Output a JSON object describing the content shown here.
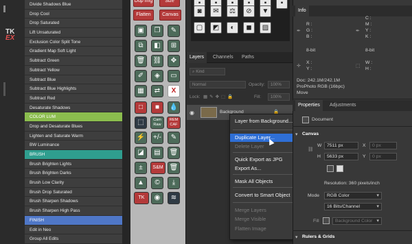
{
  "actions": [
    {
      "label": "Divide Shadows Blue",
      "type": "item"
    },
    {
      "label": "Drop Cool",
      "type": "item"
    },
    {
      "label": "Drop Saturated",
      "type": "item"
    },
    {
      "label": "Lift Unsaturated",
      "type": "item"
    },
    {
      "label": "Exclusion Color Split Tone",
      "type": "item"
    },
    {
      "label": "Gradient Map Soft Light",
      "type": "item"
    },
    {
      "label": "Subtract Green",
      "type": "item"
    },
    {
      "label": "Subtract Yellow",
      "type": "item"
    },
    {
      "label": "Subtract Blue",
      "type": "item"
    },
    {
      "label": "Subtract Blue Highlights",
      "type": "item"
    },
    {
      "label": "Subtract Red",
      "type": "item"
    },
    {
      "label": "Desaturate Shadows",
      "type": "item"
    },
    {
      "label": "COLOR LUM",
      "type": "hdr-green"
    },
    {
      "label": "Drop and Desaturate Blues",
      "type": "item"
    },
    {
      "label": "Lighten and Saturate Warm",
      "type": "item"
    },
    {
      "label": "BW Luminance",
      "type": "item"
    },
    {
      "label": "BRUSH",
      "type": "hdr-teal"
    },
    {
      "label": "Brush Brighten Lights",
      "type": "item"
    },
    {
      "label": "Brush Brighten Darks",
      "type": "item"
    },
    {
      "label": "Brush Low Clarity",
      "type": "item"
    },
    {
      "label": "Brush Drop Saturated",
      "type": "item"
    },
    {
      "label": "Brush Sharpen Shadows",
      "type": "item"
    },
    {
      "label": "Brush Sharpen High Pass",
      "type": "item"
    },
    {
      "label": "FINISH",
      "type": "hdr-blue"
    },
    {
      "label": "Edit in Neo",
      "type": "item"
    },
    {
      "label": "Group All Edits",
      "type": "item"
    }
  ],
  "strip": {
    "logo_line1": "TK",
    "logo_line2": "EX"
  },
  "buttons": {
    "dup_img": "Dup Img",
    "size": "Size",
    "flatten": "Flatten",
    "canvas": "Canvas",
    "cam_raw": "Cam Raw",
    "rem_caf": "REM CAF",
    "plus_minus": "+/-",
    "sam": "S&M",
    "tk": "TK",
    "x": "X",
    "pm_num": "±"
  },
  "layers_panel": {
    "tabs": [
      "Layers",
      "Channels",
      "Paths"
    ],
    "kind_placeholder": "Kind",
    "blend_mode": "Normal",
    "opacity_label": "Opacity:",
    "opacity_value": "100%",
    "lock_label": "Lock:",
    "fill_label": "Fill:",
    "fill_value": "100%",
    "layer_name": "Background"
  },
  "context_menu": {
    "items": [
      {
        "label": "Layer from Background...",
        "state": "normal"
      },
      {
        "label": "Duplicate Layer...",
        "state": "selected"
      },
      {
        "label": "Delete Layer",
        "state": "disabled"
      },
      {
        "label": "Quick Export as JPG",
        "state": "normal"
      },
      {
        "label": "Export As...",
        "state": "normal"
      },
      {
        "label": "Mask All Objects",
        "state": "normal"
      },
      {
        "label": "Convert to Smart Object",
        "state": "normal"
      },
      {
        "label": "Merge Layers",
        "state": "disabled"
      },
      {
        "label": "Merge Visible",
        "state": "disabled"
      },
      {
        "label": "Flatten Image",
        "state": "disabled"
      }
    ]
  },
  "info_panel": {
    "title": "Info",
    "r": "R :",
    "g": "G :",
    "b": "B :",
    "bit_left": "8-bit",
    "c": "C :",
    "m": "M :",
    "y": "Y :",
    "k": "K :",
    "bit_right": "8-bit",
    "x": "X :",
    "y2": "Y :",
    "w": "W :",
    "h": "H :",
    "doc": "Doc: 242.1M/242.1M",
    "profile": "ProPhoto RGB (16bpc)",
    "move": "Move"
  },
  "properties_panel": {
    "tabs": [
      "Properties",
      "Adjustments"
    ],
    "document_label": "Document",
    "canvas_label": "Canvas",
    "w_label": "W",
    "w_value": "7511 px",
    "x_label": "X",
    "x_value": "0 px",
    "h_label": "H",
    "h_value": "5633 px",
    "y_label": "Y",
    "y_value": "0 px",
    "resolution": "Resolution: 360 pixels/inch",
    "mode_label": "Mode",
    "mode_value": "RGB Color",
    "bits_value": "16 Bits/Channel",
    "fill_label": "Fill",
    "fill_value": "Background Color",
    "rulers_label": "Rulers & Grids"
  }
}
